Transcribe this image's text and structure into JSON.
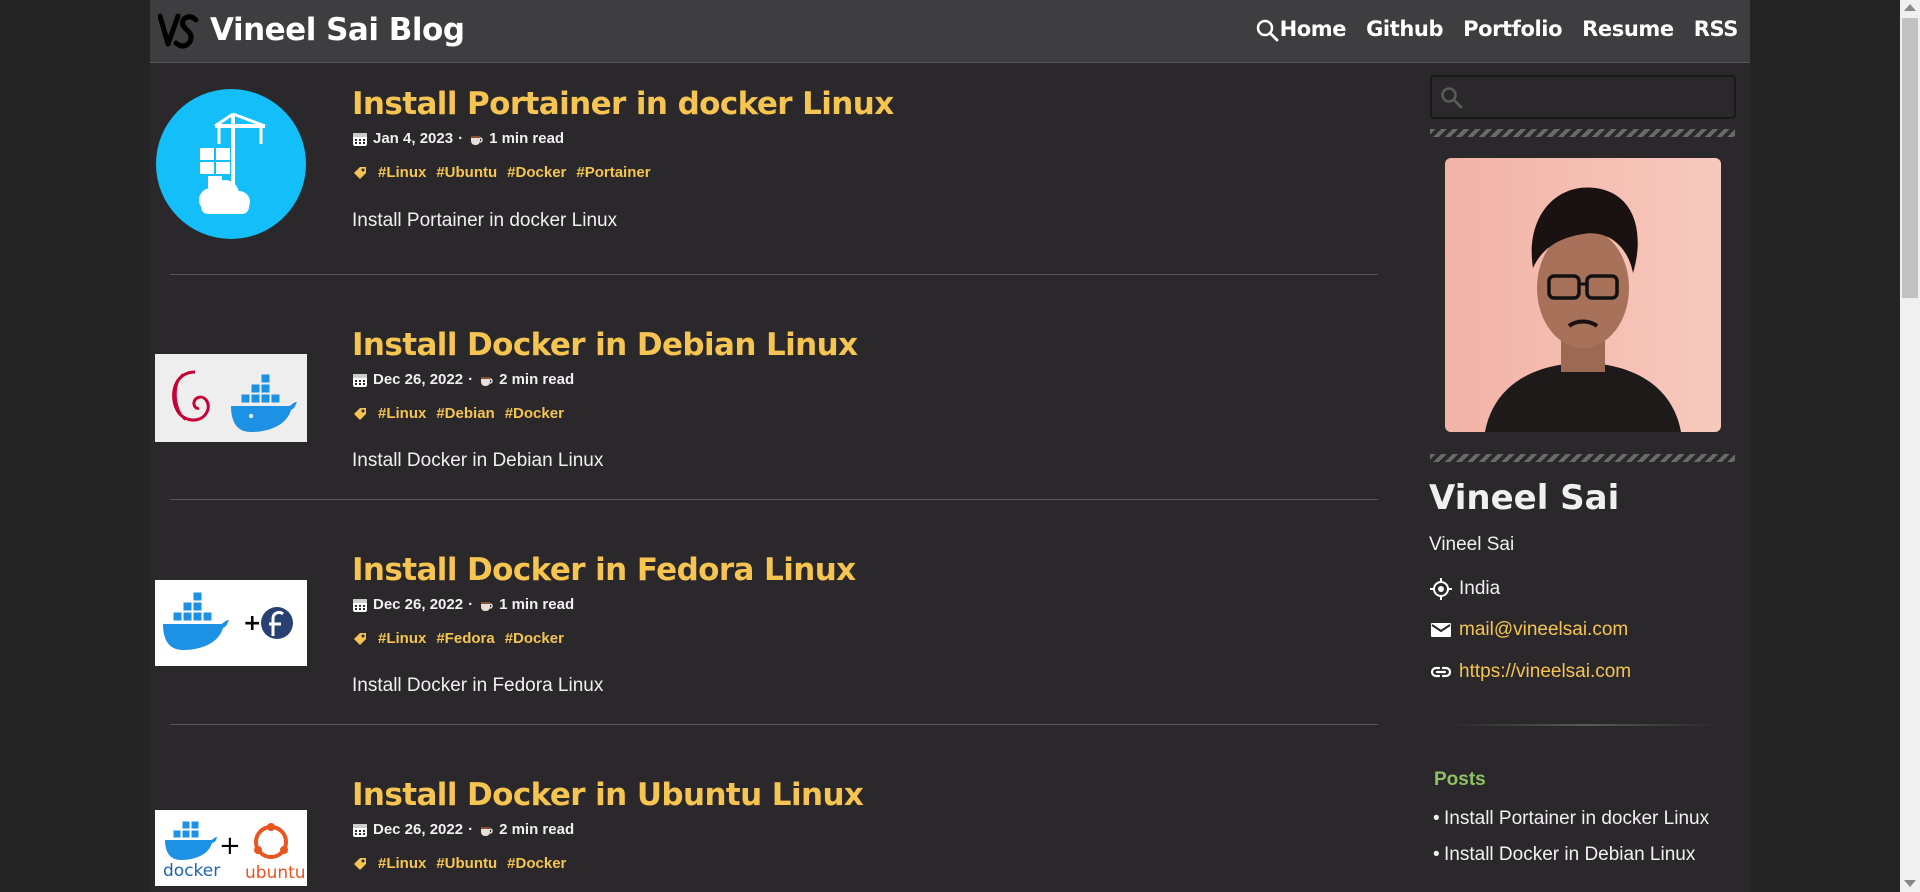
{
  "navbar": {
    "site_title": "Vineel Sai Blog",
    "links": [
      "Home",
      "Github",
      "Portfolio",
      "Resume",
      "RSS"
    ]
  },
  "posts": [
    {
      "title": "Install Portainer in docker Linux",
      "date": "Jan 4, 2023",
      "read_time": "1 min read",
      "tags": [
        "#Linux",
        "#Ubuntu",
        "#Docker",
        "#Portainer"
      ],
      "summary": "Install Portainer in docker Linux",
      "thumbnail_icon": "portainer-logo"
    },
    {
      "title": "Install Docker in Debian Linux",
      "date": "Dec 26, 2022",
      "read_time": "2 min read",
      "tags": [
        "#Linux",
        "#Debian",
        "#Docker"
      ],
      "summary": "Install Docker in Debian Linux",
      "thumbnail_icon": "debian-docker-logo"
    },
    {
      "title": "Install Docker in Fedora Linux",
      "date": "Dec 26, 2022",
      "read_time": "1 min read",
      "tags": [
        "#Linux",
        "#Fedora",
        "#Docker"
      ],
      "summary": "Install Docker in Fedora Linux",
      "thumbnail_icon": "docker-fedora-logo"
    },
    {
      "title": "Install Docker in Ubuntu Linux",
      "date": "Dec 26, 2022",
      "read_time": "2 min read",
      "tags": [
        "#Linux",
        "#Ubuntu",
        "#Docker"
      ],
      "summary": "",
      "thumbnail_icon": "docker-ubuntu-logo"
    }
  ],
  "thumbnail_text": {
    "docker": "docker",
    "ubuntu": "ubuntu",
    "plus": "+"
  },
  "sidebar": {
    "search_placeholder": "",
    "author_name": "Vineel Sai",
    "author_subtitle": "Vineel Sai",
    "location": "India",
    "email": "mail@vineelsai.com",
    "website": "https://vineelsai.com",
    "posts_heading": "Posts",
    "recent_posts": [
      "Install Portainer in docker Linux",
      "Install Docker in Debian Linux"
    ]
  },
  "colors": {
    "accent": "#f5c451",
    "background": "#2a282a",
    "navbar": "#3e3d3f",
    "posts_heading": "#8fc063"
  }
}
